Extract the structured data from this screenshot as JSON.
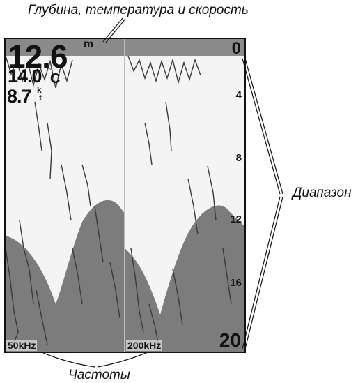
{
  "callouts": {
    "top": "Глубина, температура и скорость",
    "right": "Диапазон",
    "bottom": "Частоты"
  },
  "readouts": {
    "depth": "12.6",
    "depth_unit": "m",
    "temperature": "14.0",
    "temperature_unit_deg": "°",
    "temperature_unit": "C",
    "speed": "8.7",
    "speed_unit_k": "k",
    "speed_unit_t": "t"
  },
  "depth_scale": {
    "top": "0",
    "ticks": [
      "4",
      "8",
      "12",
      "16"
    ],
    "bottom": "20"
  },
  "frequencies": {
    "left": "50kHz",
    "right": "200kHz"
  },
  "colors": {
    "bottom_fill": "#7c7c7c",
    "water": "#f4f4f4",
    "clutter": "#3a3a3a",
    "divider": "#bdbdbd"
  }
}
